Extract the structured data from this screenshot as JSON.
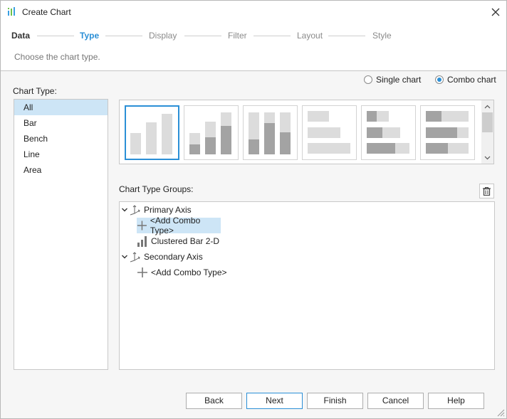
{
  "window": {
    "title": "Create Chart",
    "app_icon": "chart-app-icon",
    "close_icon": "close-icon"
  },
  "steps": [
    {
      "label": "Data",
      "state": "done"
    },
    {
      "label": "Type",
      "state": "active"
    },
    {
      "label": "Display",
      "state": "pending"
    },
    {
      "label": "Filter",
      "state": "pending"
    },
    {
      "label": "Layout",
      "state": "pending"
    },
    {
      "label": "Style",
      "state": "pending"
    }
  ],
  "subtitle": "Choose the chart type.",
  "mode": {
    "single_label": "Single chart",
    "combo_label": "Combo chart",
    "selected": "combo"
  },
  "chart_type": {
    "label": "Chart Type:",
    "items": [
      "All",
      "Bar",
      "Bench",
      "Line",
      "Area"
    ],
    "selected_index": 0
  },
  "gallery": {
    "thumbnails": [
      "clustered-column-icon",
      "stacked-column-icon",
      "percent-stacked-column-icon",
      "clustered-bar-icon",
      "stacked-bar-icon",
      "percent-stacked-bar-icon"
    ],
    "selected_index": 0
  },
  "groups": {
    "label": "Chart Type Groups:",
    "delete_icon": "trash-icon",
    "tree": {
      "primary": {
        "label": "Primary Axis",
        "add": "<Add Combo Type>",
        "child": "Clustered Bar 2-D"
      },
      "secondary": {
        "label": "Secondary Axis",
        "add": "<Add Combo Type>"
      }
    }
  },
  "buttons": {
    "back": "Back",
    "next": "Next",
    "finish": "Finish",
    "cancel": "Cancel",
    "help": "Help"
  },
  "colors": {
    "accent": "#2b8fd6",
    "selection": "#cde5f6",
    "bar_dark": "#a3a3a3",
    "bar_light": "#dcdcdc"
  }
}
